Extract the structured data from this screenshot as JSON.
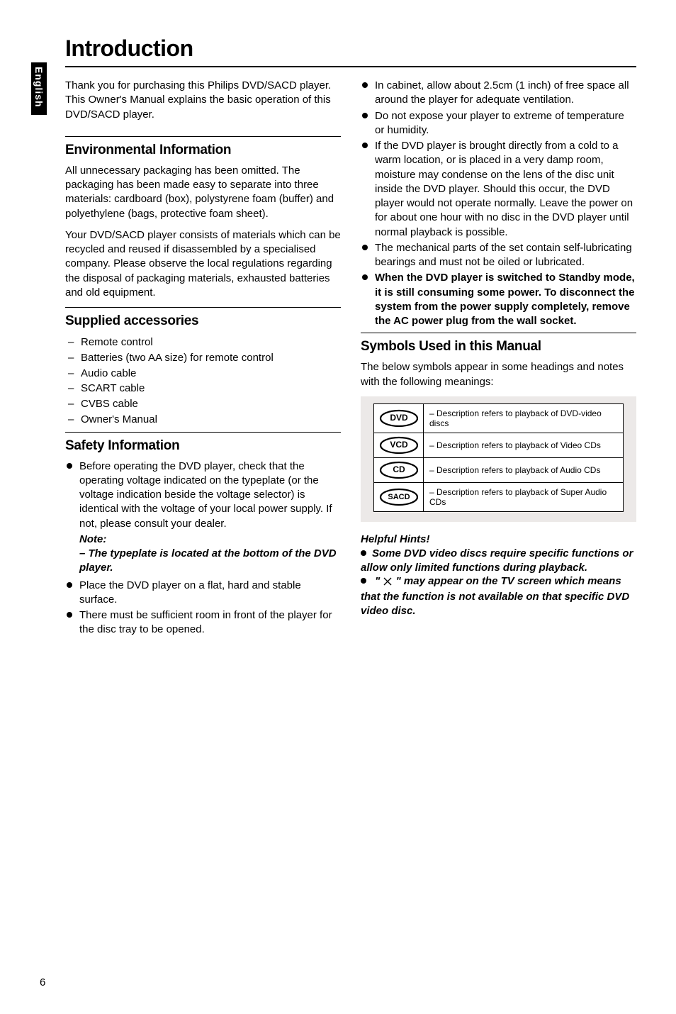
{
  "language_tab": "English",
  "page_number": "6",
  "title": "Introduction",
  "left": {
    "intro": "Thank you for purchasing this Philips DVD/SACD player. This Owner's Manual explains the basic operation of this DVD/SACD player.",
    "env": {
      "heading": "Environmental Information",
      "p1": "All unnecessary packaging has been omitted. The packaging has been made easy to separate into three materials: cardboard (box), polystyrene foam (buffer) and polyethylene (bags, protective foam sheet).",
      "p2": "Your DVD/SACD player consists of materials which can be recycled and reused if disassembled by a specialised company. Please observe the local regulations regarding the disposal of packaging materials, exhausted batteries and old equipment."
    },
    "supplied": {
      "heading": "Supplied accessories",
      "items": [
        "Remote control",
        "Batteries (two AA size) for remote control",
        "Audio cable",
        "SCART cable",
        "CVBS cable",
        "Owner's Manual"
      ]
    },
    "safety": {
      "heading": "Safety Information",
      "b1": "Before operating the DVD player, check that the operating voltage indicated on the typeplate (or the voltage indication beside the voltage selector) is identical with the voltage of your local power supply. If not, please consult your dealer.",
      "note_label": "Note:",
      "note_text": "–   The typeplate is located at the bottom of the DVD player.",
      "b2": "Place the DVD player on a flat, hard and stable surface.",
      "b3": "There must be sufficient room in front of the player for the disc tray to be opened."
    }
  },
  "right": {
    "safety_cont": {
      "b1": "In cabinet, allow about 2.5cm (1 inch) of free space all around the player for adequate ventilation.",
      "b2": "Do not expose your player to extreme of temperature or humidity.",
      "b3": "If the DVD player is brought directly from a cold to a warm location, or is placed in a very damp room, moisture may condense on the lens of the disc unit inside the DVD player. Should this occur, the DVD player would not operate normally. Leave the power on for about one hour with no disc in the DVD player until normal playback is possible.",
      "b4": "The mechanical parts of the set contain self-lubricating bearings and must not be oiled or lubricated.",
      "b5": "When the DVD player is switched to Standby mode, it is still consuming some power.  To disconnect the system from the power supply completely, remove the AC power plug from the wall socket."
    },
    "symbols": {
      "heading": "Symbols Used in this Manual",
      "intro": "The below symbols appear in some headings and notes with the following meanings:",
      "rows": [
        {
          "label": "DVD",
          "desc": "– Description refers to playback of DVD-video discs"
        },
        {
          "label": "VCD",
          "desc": "– Description refers to playback of Video CDs"
        },
        {
          "label": "CD",
          "desc": "– Description refers to playback of Audio CDs"
        },
        {
          "label": "SACD",
          "desc": "– Description refers to playback of Super Audio CDs"
        }
      ]
    },
    "hints": {
      "label": "Helpful Hints!",
      "h1": "Some DVD video discs require specific functions or allow only limited functions during playback.",
      "h2_pre": "\" ",
      "h2_post": " \" may appear on the TV screen which means that the function is not available on that specific DVD video disc."
    }
  }
}
